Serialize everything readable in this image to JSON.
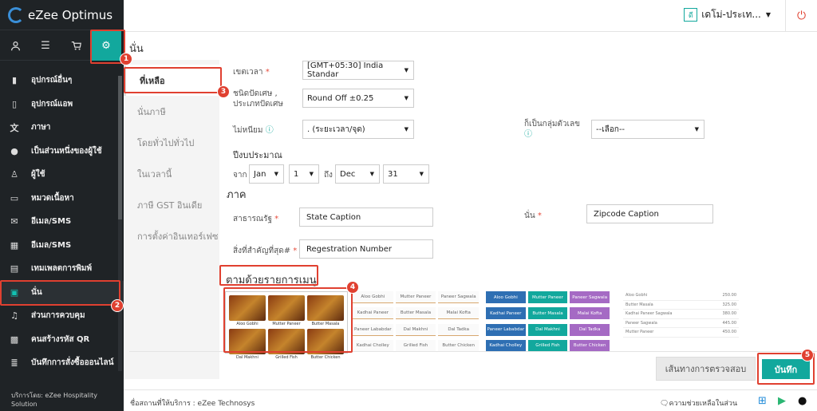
{
  "app": {
    "logo_text": "eZee Optimus"
  },
  "topbar": {
    "property_badge": "ดี",
    "property_name": "เดโม่-ประเท..."
  },
  "sidebar": {
    "items": [
      {
        "label": "อุปกรณ์อื่นๆ",
        "icon": "tablet-icon"
      },
      {
        "label": "อุปกรณ์แอพ",
        "icon": "mobile-icon"
      },
      {
        "label": "ภาษา",
        "icon": "language-icon"
      },
      {
        "label": "เป็นส่วนหนึ่งของผู้ใช้",
        "icon": "user-group-icon"
      },
      {
        "label": "ผู้ใช้",
        "icon": "user-icon"
      },
      {
        "label": "หมวดเนื้อหา",
        "icon": "inbox-icon"
      },
      {
        "label": "อีเมล/SMS",
        "icon": "envelope-icon"
      },
      {
        "label": "อีเมล/SMS",
        "icon": "calendar-icon"
      },
      {
        "label": "เทมเพลตการพิมพ์",
        "icon": "document-icon"
      },
      {
        "label": "นั่น",
        "icon": "display-icon"
      },
      {
        "label": "ส่วนการควบคุม",
        "icon": "bell-icon"
      },
      {
        "label": "คนสร้างรหัส QR",
        "icon": "qr-icon"
      },
      {
        "label": "บันทึกการสั่งซื้อออนไลน์",
        "icon": "list-icon"
      }
    ],
    "footer": "บริการโดย: eZee Hospitality Solution"
  },
  "page": {
    "title": "นั่น"
  },
  "tabs": [
    {
      "label": "ที่เหลือ"
    },
    {
      "label": "นั่นภาษี"
    },
    {
      "label": "โดยทั่วไปทั่วไป"
    },
    {
      "label": "ในเวลานี้"
    },
    {
      "label": "ภาษี GST อินเดีย"
    },
    {
      "label": "การตั้งค่าอินเทอร์เฟซ"
    }
  ],
  "form": {
    "timezone_label": "เขตเวลา",
    "timezone_value": "[GMT+05:30] India Standar",
    "rounding_label": "ชนิดปัดเศษ , ประเภทปัดเศษ",
    "rounding_value": "Round Off ±0.25",
    "format_label": "ไม่หนียม",
    "format_value": ". (ระยะเวลา/จุด)",
    "group_label": "ก็เป็นกลุ่มตัวเลข",
    "group_value": "--เลือก--",
    "fiscal_label": "ปีงบประมาณ",
    "from_label": "จาก",
    "from_month": "Jan",
    "from_day": "1",
    "to_label": "ถึง",
    "to_month": "Dec",
    "to_day": "31",
    "section_label": "ภาค",
    "state_label": "สาธารณรัฐ",
    "state_value": "State Caption",
    "zip_label": "นั่น",
    "zip_value": "Zipcode Caption",
    "reg_label": "สิ่งที่สำคัญที่สุด#",
    "reg_value": "Regestration Number",
    "menu_section": "ตามด้วยรายการเมนู"
  },
  "menu_preview": {
    "items": [
      "Aloo Gobhi",
      "Mutter Paneer",
      "Butter Masala",
      "Dal Makhni",
      "Grilled Fish",
      "Butter Chicken"
    ],
    "text_items": [
      "Aloo Gobhi",
      "Mutter Paneer",
      "Paneer Sagwala",
      "Kadhai Paneer",
      "Butter Masala",
      "Malai Kofta",
      "Paneer Lababdar",
      "Dal Makhni",
      "Dal Tadka",
      "Kadhai Cholley",
      "Grilled Fish",
      "Butter Chicken"
    ],
    "price_list": [
      {
        "name": "Aloo Gobhi",
        "price": "250.00"
      },
      {
        "name": "Butter Masala",
        "price": "325.00"
      },
      {
        "name": "Kadhai Paneer Sagwala",
        "price": "380.00"
      },
      {
        "name": "Paneer Sagwala",
        "price": "445.00"
      },
      {
        "name": "Mutter Paneer",
        "price": "450.00"
      }
    ],
    "tile_colors": [
      "#2e6fb3",
      "#12a89d",
      "#a56ac4"
    ]
  },
  "actions": {
    "audit_label": "เส้นทางการตรวจสอบ",
    "save_label": "บันทึก"
  },
  "bottombar": {
    "host": "ชื่อสถานที่ให้บริการ : eZee Technosys",
    "help": "ความช่วยเหลือในส่วน"
  },
  "markers": [
    "1",
    "2",
    "3",
    "4",
    "5"
  ]
}
